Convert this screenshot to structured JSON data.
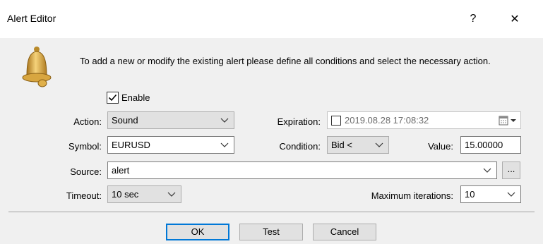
{
  "window": {
    "title": "Alert Editor",
    "help_glyph": "?",
    "close_glyph": "✕"
  },
  "intro": {
    "icon": "bell-icon",
    "text": "To add a new or modify the existing alert please define all conditions and select the necessary action."
  },
  "enable": {
    "label": "Enable",
    "checked": true
  },
  "fields": {
    "action": {
      "label": "Action:",
      "value": "Sound"
    },
    "expiration": {
      "label": "Expiration:",
      "value": "2019.08.28 17:08:32",
      "checked": false
    },
    "symbol": {
      "label": "Symbol:",
      "value": "EURUSD"
    },
    "condition": {
      "label": "Condition:",
      "value": "Bid <"
    },
    "value": {
      "label": "Value:",
      "value": "15.00000"
    },
    "source": {
      "label": "Source:",
      "value": "alert",
      "browse_label": "..."
    },
    "timeout": {
      "label": "Timeout:",
      "value": "10 sec"
    },
    "max_iterations": {
      "label": "Maximum iterations:",
      "value": "10"
    }
  },
  "buttons": {
    "ok": "OK",
    "test": "Test",
    "cancel": "Cancel"
  },
  "colors": {
    "accent": "#0078d7",
    "bell": "#e3b23c"
  }
}
